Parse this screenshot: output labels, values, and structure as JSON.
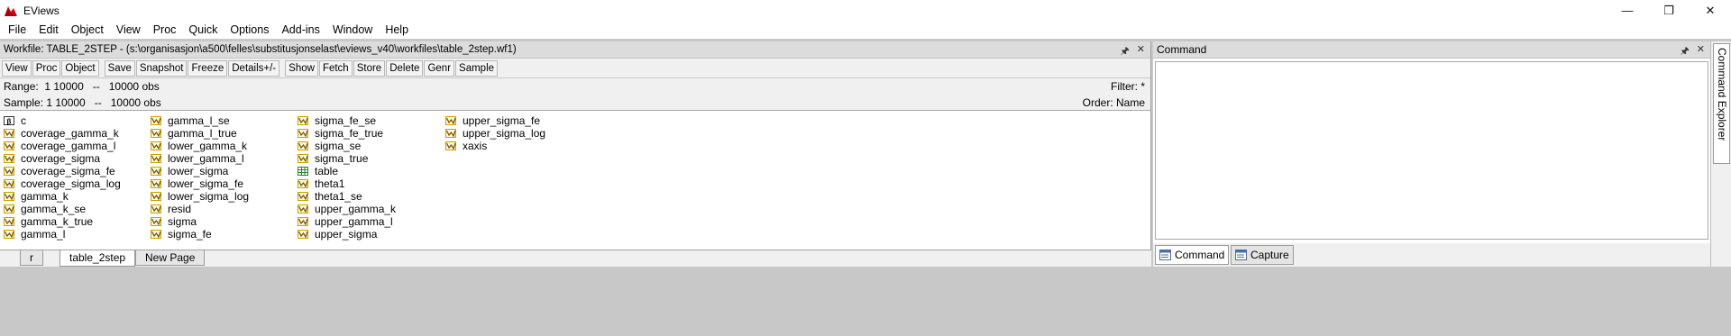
{
  "app": {
    "title": "EViews"
  },
  "window_controls": {
    "minimize": "—",
    "restore": "❐",
    "close": "✕"
  },
  "menu": [
    "File",
    "Edit",
    "Object",
    "View",
    "Proc",
    "Quick",
    "Options",
    "Add-ins",
    "Window",
    "Help"
  ],
  "workfile": {
    "title": "Workfile: TABLE_2STEP - (s:\\organisasjon\\a500\\felles\\substitusjonselast\\eviews_v40\\workfiles\\table_2step.wf1)",
    "toolbar": [
      "View",
      "Proc",
      "Object",
      "Save",
      "Snapshot",
      "Freeze",
      "Details+/-",
      "Show",
      "Fetch",
      "Store",
      "Delete",
      "Genr",
      "Sample"
    ],
    "range": "Range:  1 10000   --   10000 obs",
    "filter": "Filter: *",
    "sample": "Sample: 1 10000   --   10000 obs",
    "order": "Order: Name",
    "objects_col1": [
      {
        "name": "c",
        "icon": "coef-icon"
      },
      {
        "name": "coverage_gamma_k",
        "icon": "series-icon"
      },
      {
        "name": "coverage_gamma_l",
        "icon": "series-icon"
      },
      {
        "name": "coverage_sigma",
        "icon": "series-icon"
      },
      {
        "name": "coverage_sigma_fe",
        "icon": "series-icon"
      },
      {
        "name": "coverage_sigma_log",
        "icon": "series-icon"
      },
      {
        "name": "gamma_k",
        "icon": "series-icon"
      },
      {
        "name": "gamma_k_se",
        "icon": "series-icon"
      },
      {
        "name": "gamma_k_true",
        "icon": "series-icon"
      },
      {
        "name": "gamma_l",
        "icon": "series-icon"
      }
    ],
    "objects_col2": [
      {
        "name": "gamma_l_se",
        "icon": "series-icon"
      },
      {
        "name": "gamma_l_true",
        "icon": "series-icon"
      },
      {
        "name": "lower_gamma_k",
        "icon": "series-icon"
      },
      {
        "name": "lower_gamma_l",
        "icon": "series-icon"
      },
      {
        "name": "lower_sigma",
        "icon": "series-icon"
      },
      {
        "name": "lower_sigma_fe",
        "icon": "series-icon"
      },
      {
        "name": "lower_sigma_log",
        "icon": "series-icon"
      },
      {
        "name": "resid",
        "icon": "series-icon"
      },
      {
        "name": "sigma",
        "icon": "series-icon"
      },
      {
        "name": "sigma_fe",
        "icon": "series-icon"
      }
    ],
    "objects_col3": [
      {
        "name": "sigma_fe_se",
        "icon": "series-icon"
      },
      {
        "name": "sigma_fe_true",
        "icon": "series-icon"
      },
      {
        "name": "sigma_se",
        "icon": "series-icon"
      },
      {
        "name": "sigma_true",
        "icon": "series-icon"
      },
      {
        "name": "table",
        "icon": "table-icon"
      },
      {
        "name": "theta1",
        "icon": "series-icon"
      },
      {
        "name": "theta1_se",
        "icon": "series-icon"
      },
      {
        "name": "upper_gamma_k",
        "icon": "series-icon"
      },
      {
        "name": "upper_gamma_l",
        "icon": "series-icon"
      },
      {
        "name": "upper_sigma",
        "icon": "series-icon"
      }
    ],
    "objects_col4": [
      {
        "name": "upper_sigma_fe",
        "icon": "series-icon"
      },
      {
        "name": "upper_sigma_log",
        "icon": "series-icon"
      },
      {
        "name": "xaxis",
        "icon": "series-icon"
      }
    ],
    "page_tabs": [
      "r",
      "table_2step",
      "New Page"
    ],
    "active_tab": "table_2step"
  },
  "command": {
    "title": "Command",
    "tabs": [
      "Command",
      "Capture"
    ]
  },
  "side_panel": {
    "label": "Command Explorer"
  },
  "colors": {
    "series_icon": "#c8a000",
    "coef_icon": "#c8a000",
    "table_icon": "#2e7d32"
  }
}
